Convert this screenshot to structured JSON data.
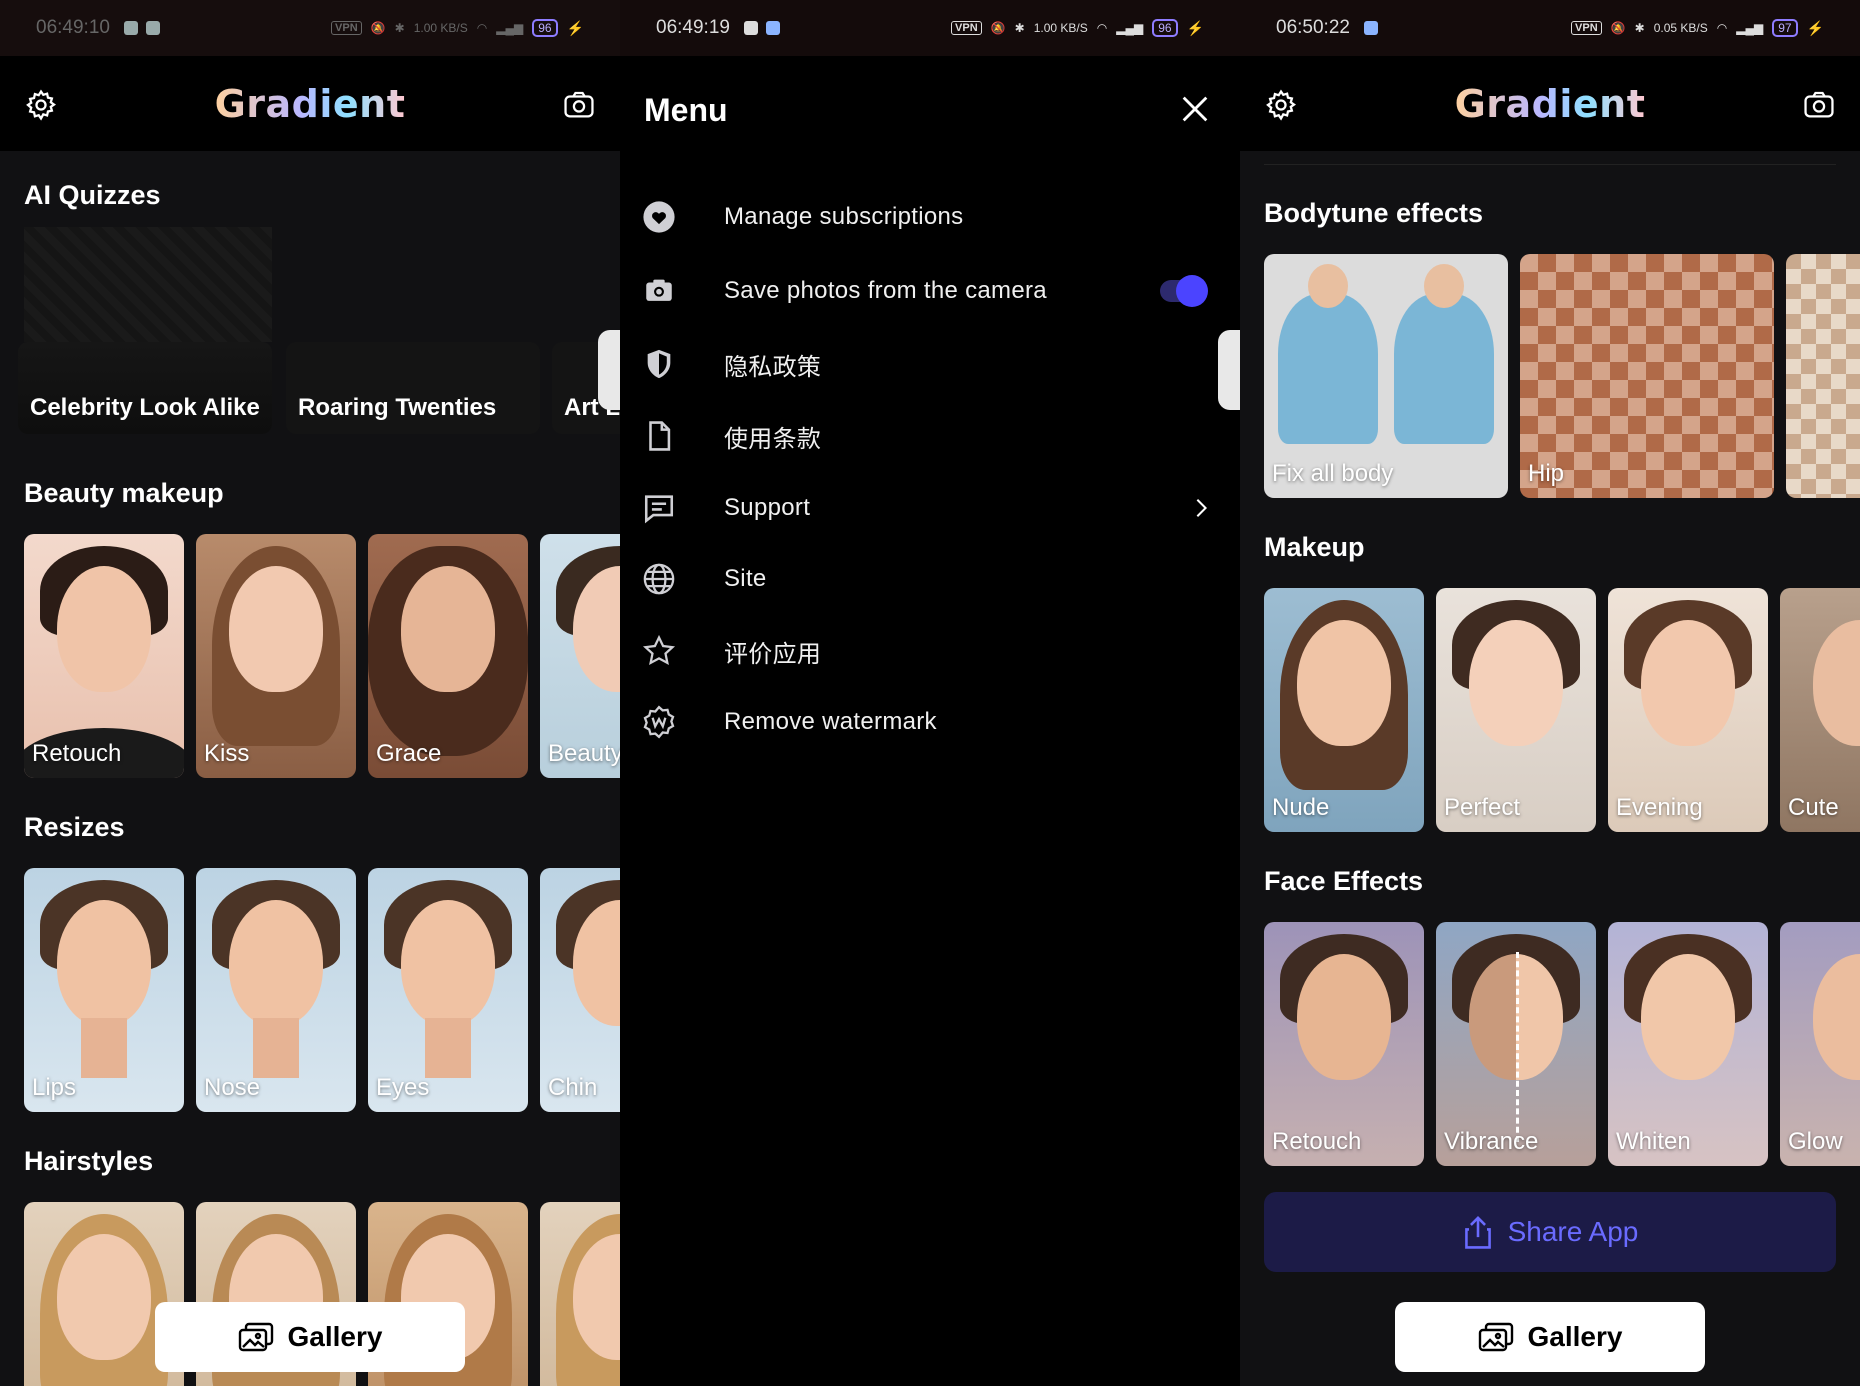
{
  "panel1": {
    "status": {
      "time": "06:49:10",
      "net_speed": "1.00",
      "net_unit": "KB/S",
      "battery": "96"
    },
    "app_title": "Gradient",
    "sections": [
      {
        "title": "AI Quizzes",
        "items": [
          "Celebrity Look Alike",
          "Roaring Twenties",
          "Art L"
        ]
      },
      {
        "title": "Beauty makeup",
        "items": [
          "Retouch",
          "Kiss",
          "Grace",
          "Beauty"
        ]
      },
      {
        "title": "Resizes",
        "items": [
          "Lips",
          "Nose",
          "Eyes",
          "Chin"
        ]
      },
      {
        "title": "Hairstyles",
        "items": [
          "",
          "",
          "",
          ""
        ]
      }
    ],
    "gallery_label": "Gallery"
  },
  "panel2": {
    "status": {
      "time": "06:49:19",
      "net_speed": "1.00",
      "net_unit": "KB/S",
      "battery": "96"
    },
    "menu_title": "Menu",
    "items": [
      {
        "icon": "heart-icon",
        "label": "Manage subscriptions"
      },
      {
        "icon": "camera-icon",
        "label": "Save photos from the camera",
        "toggle": true
      },
      {
        "icon": "shield-icon",
        "label": "隐私政策"
      },
      {
        "icon": "document-icon",
        "label": "使用条款"
      },
      {
        "icon": "chat-icon",
        "label": "Support",
        "chevron": true
      },
      {
        "icon": "globe-icon",
        "label": "Site"
      },
      {
        "icon": "star-icon",
        "label": "评价应用"
      },
      {
        "icon": "watermark-icon",
        "label": "Remove watermark"
      }
    ]
  },
  "panel3": {
    "status": {
      "time": "06:50:22",
      "net_speed": "0.05",
      "net_unit": "KB/S",
      "battery": "97"
    },
    "app_title": "Gradient",
    "sections": [
      {
        "title": "Bodytune effects",
        "items": [
          "Fix all body",
          "Hip",
          ""
        ]
      },
      {
        "title": "Makeup",
        "items": [
          "Nude",
          "Perfect",
          "Evening",
          "Cute"
        ]
      },
      {
        "title": "Face Effects",
        "items": [
          "Retouch",
          "Vibrance",
          "Whiten",
          "Glow"
        ]
      }
    ],
    "share_label": "Share App",
    "gallery_label": "Gallery"
  },
  "colors": {
    "accent": "#4b44ff",
    "share_bg": "#1c1b47",
    "share_text": "#6a6bff",
    "background": "#111113"
  }
}
